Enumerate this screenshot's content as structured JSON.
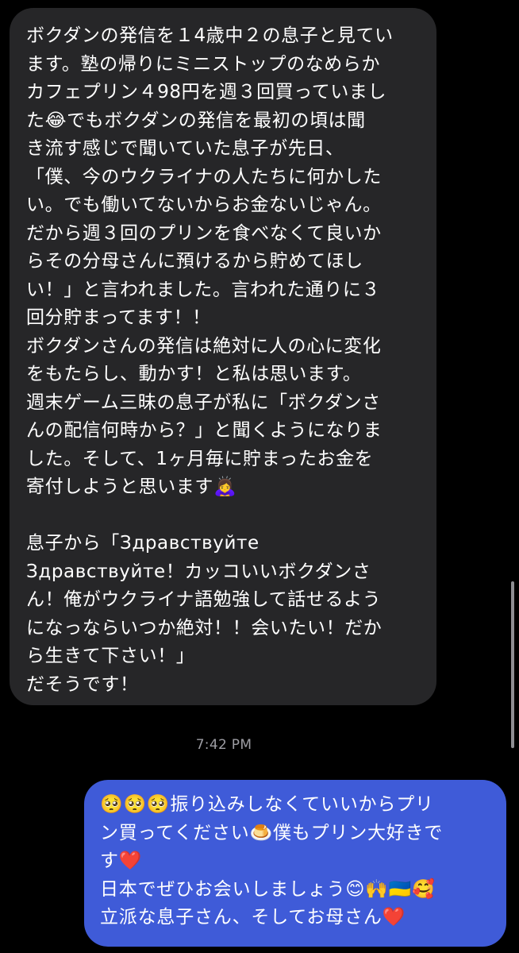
{
  "conversation": {
    "incoming_message": {
      "lines": [
        "ボクダンの発信を１4歳中２の息子と見てい",
        "ます。塾の帰りにミニストップのなめらか",
        "カフェプリン４98円を週３回買っていまし",
        "た😂でもボクダンの発信を最初の頃は聞",
        "き流す感じで聞いていた息子が先日、",
        "「僕、今のウクライナの人たちに何かした",
        "い。でも働いてないからお金ないじゃん。",
        "だから週３回のプリンを食べなくて良いか",
        "らその分母さんに預けるから貯めてほし",
        "い！」と言われました。言われた通りに３",
        "回分貯まってます！！",
        "ボクダンさんの発信は絶対に人の心に変化",
        "をもたらし、動かす！と私は思います。",
        "週末ゲーム三昧の息子が私に「ボクダンさ",
        "んの配信何時から？」と聞くようになりま",
        "した。そして、1ヶ月毎に貯まったお金を",
        "寄付しようと思います🙇‍♀️",
        "",
        "息子から「Здравствуйте",
        "Здравствуйте！カッコいいボクダンさ",
        "ん！俺がウクライナ語勉強して話せるよう",
        "になっならいつか絶対！！会いたい！だか",
        "ら生きて下さい！」",
        "だそうです！"
      ]
    },
    "timestamp": "7:42 PM",
    "outgoing_message": {
      "lines": [
        "🥺🥺🥺振り込みしなくていいからプリ",
        "ン買ってください🍮僕もプリン大好きで",
        "す❤️",
        "日本でぜひお会いしましょう😊🙌🇺🇦🥰",
        "立派な息子さん、そしてお母さん❤️"
      ]
    }
  },
  "colors": {
    "background": "#000000",
    "incoming_bubble": "#262628",
    "outgoing_bubble": "#3f5bd8",
    "timestamp_text": "#9d9da3"
  }
}
